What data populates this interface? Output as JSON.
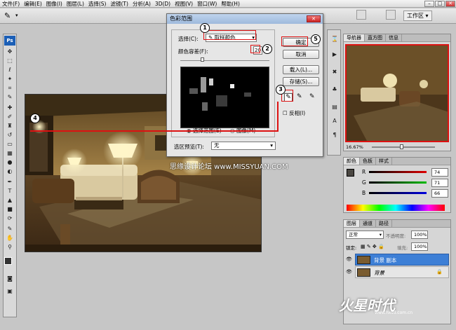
{
  "menu": [
    "文件(F)",
    "编辑(E)",
    "图像(I)",
    "图层(L)",
    "选择(S)",
    "滤镜(T)",
    "分析(A)",
    "3D(D)",
    "视图(V)",
    "窗口(W)",
    "帮助(H)"
  ],
  "workspace_label": "工作区 ▾",
  "dialog": {
    "title": "色彩范围",
    "select_label": "选择(C):",
    "select_value": "取样颜色",
    "fuzziness_label": "颜色容差(F):",
    "fuzziness_value": "20",
    "ok": "确定",
    "cancel": "取消",
    "load": "载入(L)...",
    "save": "存储(S)...",
    "invert": "反相(I)",
    "radio_selection": "选择范围(E)",
    "radio_image": "图像(M)",
    "preview_label": "选区预览(T):",
    "preview_value": "无"
  },
  "callouts": [
    "1",
    "2",
    "3",
    "4",
    "5"
  ],
  "watermark": "思缘设计论坛 www.MISSYUAN.COM",
  "navigator": {
    "tabs": [
      "导航器",
      "直方图",
      "信息"
    ],
    "zoom": "16.67%"
  },
  "color_panel": {
    "tabs": [
      "颜色",
      "色板",
      "样式"
    ],
    "r_label": "R",
    "r_value": "74",
    "g_label": "G",
    "g_value": "71",
    "b_label": "B",
    "b_value": "66"
  },
  "layers_panel": {
    "tabs": [
      "图层",
      "通道",
      "路径"
    ],
    "blend_mode": "正常",
    "opacity_label": "不透明度:",
    "opacity_value": "100%",
    "lock_label": "锁定:",
    "fill_label": "填充:",
    "fill_value": "100%",
    "layers": [
      {
        "name": "背景 副本",
        "selected": true
      },
      {
        "name": "背景",
        "selected": false
      }
    ]
  },
  "logo": "火星时代",
  "logo_url": "www.hxsd.com.cn",
  "colors": {
    "accent_red": "#dd1111",
    "layer_selected": "#3d7fd6"
  }
}
